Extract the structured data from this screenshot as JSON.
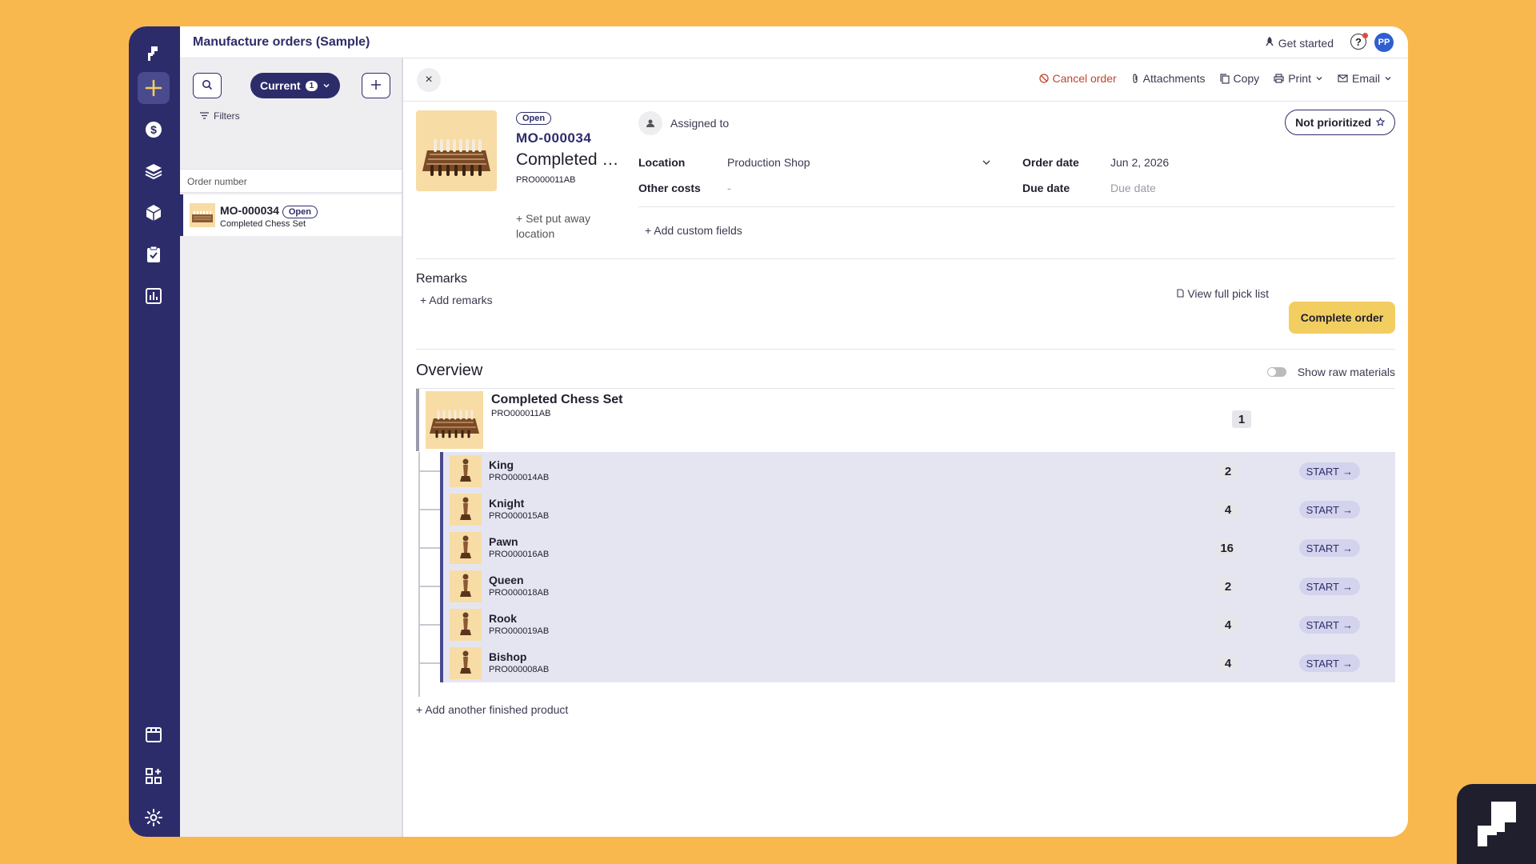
{
  "header": {
    "title": "Manufacture orders (Sample)",
    "get_started": "Get started",
    "help": "?",
    "avatar": "PP"
  },
  "list": {
    "current_label": "Current",
    "current_count": "1",
    "filters_label": "Filters",
    "column_header": "Order number",
    "rows": [
      {
        "number": "MO-000034",
        "status": "Open",
        "product": "Completed Chess Set"
      }
    ]
  },
  "detail": {
    "actions": {
      "cancel": "Cancel order",
      "attachments": "Attachments",
      "copy": "Copy",
      "print": "Print",
      "email": "Email"
    },
    "status": "Open",
    "number": "MO-000034",
    "product_title": "Completed Chess Set",
    "product_code": "PRO000011AB",
    "put_away": "+ Set put away location",
    "assigned_to": "Assigned to",
    "priority": "Not prioritized",
    "location_label": "Location",
    "location_value": "Production Shop",
    "other_costs_label": "Other costs",
    "other_costs_value": "-",
    "order_date_label": "Order date",
    "order_date_value": "Jun 2, 2026",
    "due_date_label": "Due date",
    "due_date_placeholder": "Due date",
    "add_custom_fields": "Add custom fields",
    "remarks_heading": "Remarks",
    "add_remarks": "Add remarks",
    "view_pick_list": "View full pick list",
    "complete_order": "Complete order",
    "overview_heading": "Overview",
    "show_raw_materials": "Show raw materials",
    "add_another": "+ Add another finished product"
  },
  "overview": {
    "parent": {
      "name": "Completed Chess Set",
      "code": "PRO000011AB",
      "qty": "1"
    },
    "start_label": "START",
    "children": [
      {
        "name": "King",
        "code": "PRO000014AB",
        "qty": "2"
      },
      {
        "name": "Knight",
        "code": "PRO000015AB",
        "qty": "4"
      },
      {
        "name": "Pawn",
        "code": "PRO000016AB",
        "qty": "16"
      },
      {
        "name": "Queen",
        "code": "PRO000018AB",
        "qty": "2"
      },
      {
        "name": "Rook",
        "code": "PRO000019AB",
        "qty": "4"
      },
      {
        "name": "Bishop",
        "code": "PRO000008AB",
        "qty": "4"
      }
    ]
  },
  "rail_icons": [
    "logo-icon",
    "plus-icon",
    "dollar-icon",
    "layers-icon",
    "box-icon",
    "clipboard-check-icon",
    "bar-chart-icon",
    "shop-icon",
    "apps-add-icon",
    "gear-icon"
  ],
  "colors": {
    "background": "#f8b84e",
    "rail": "#2d2c6b",
    "primary": "#2d2c6b",
    "accent_button": "#f2cd60",
    "cancel_red": "#c2452d",
    "child_row": "#e5e5f2"
  }
}
